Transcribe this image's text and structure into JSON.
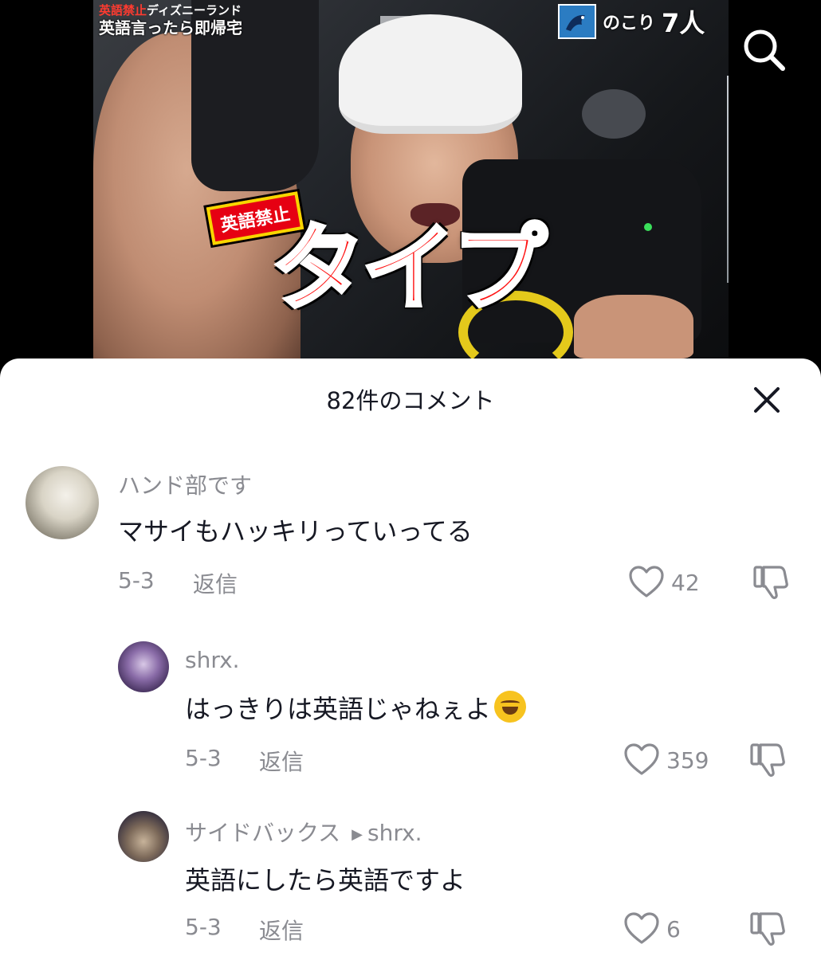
{
  "video": {
    "title_tag": "英語禁止",
    "title_tag_rest": "ディズニーランド",
    "subtitle": "英語言ったら即帰宅",
    "badge": "英語禁止",
    "caption": "タイプ",
    "remaining_label": "のこり",
    "remaining_count": "7人"
  },
  "sheet": {
    "title": "82件のコメント"
  },
  "comments": [
    {
      "author": "ハンド部です",
      "text": "マサイもハッキリっていってる",
      "date": "5-3",
      "reply_label": "返信",
      "likes": "42"
    },
    {
      "author": "shrx.",
      "text": "はっきりは英語じゃねぇよ",
      "emoji": "rolling-on-floor-laughing-emoji",
      "date": "5-3",
      "reply_label": "返信",
      "likes": "359"
    },
    {
      "author": "サイドバックス",
      "reply_to": "shrx.",
      "text": "英語にしたら英語ですよ",
      "date": "5-3",
      "reply_label": "返信",
      "likes": "6"
    }
  ],
  "icons": {
    "search": "search-icon",
    "close": "close-icon",
    "like": "heart-icon",
    "dislike": "thumbs-down-icon"
  },
  "colors": {
    "caption_red": "#ff1212",
    "badge_red": "#e60012",
    "badge_yellow": "#f7d600",
    "text_primary": "#161823",
    "text_secondary": "#8a8b91"
  }
}
